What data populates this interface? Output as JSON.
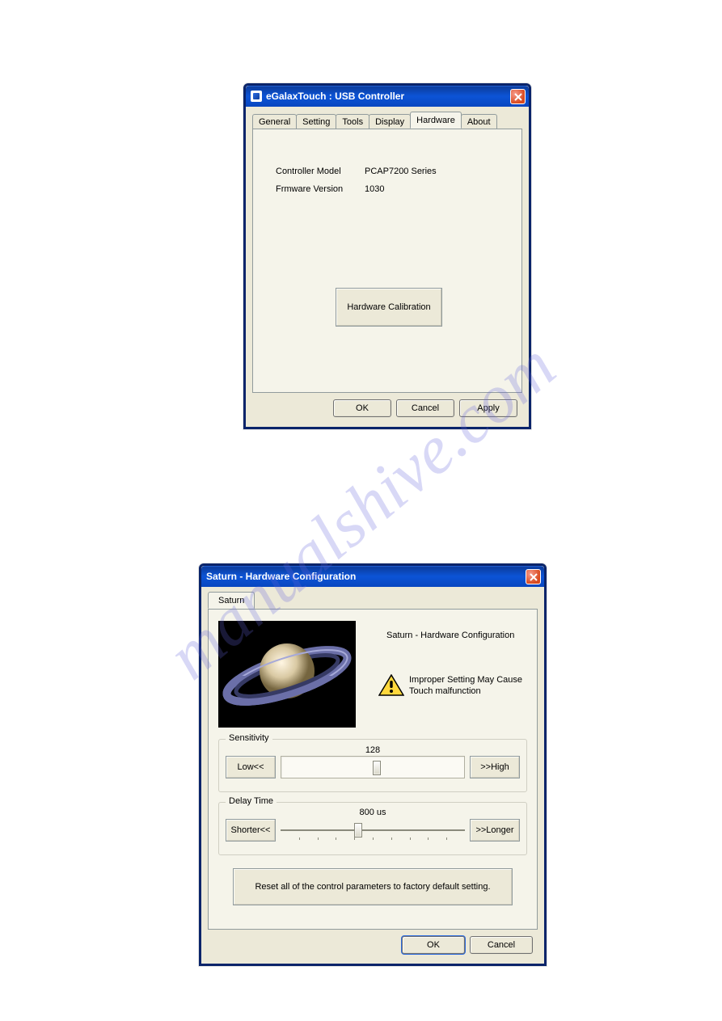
{
  "window1": {
    "title": "eGalaxTouch : USB Controller",
    "tabs": [
      "General",
      "Setting",
      "Tools",
      "Display",
      "Hardware",
      "About"
    ],
    "active_tab_index": 4,
    "controller_model_label": "Controller Model",
    "controller_model_value": "PCAP7200 Series",
    "firmware_version_label": "Frmware Version",
    "firmware_version_value": "1030",
    "hardware_calibration_btn": "Hardware Calibration",
    "ok_btn": "OK",
    "cancel_btn": "Cancel",
    "apply_btn": "Apply"
  },
  "window2": {
    "title": "Saturn - Hardware Configuration",
    "tab_label": "Saturn",
    "heading": "Saturn - Hardware Configuration",
    "warning_text": "Improper Setting May Cause Touch malfunction",
    "sensitivity": {
      "legend": "Sensitivity",
      "low_btn": "Low<<",
      "high_btn": ">>High",
      "value_label": "128",
      "value": 128,
      "min": 0,
      "max": 255
    },
    "delay": {
      "legend": "Delay Time",
      "shorter_btn": "Shorter<<",
      "longer_btn": ">>Longer",
      "value_label": "800 us",
      "value": 800,
      "min": 0,
      "max": 2000
    },
    "reset_btn": "Reset all of the control parameters to factory default setting.",
    "ok_btn": "OK",
    "cancel_btn": "Cancel"
  }
}
